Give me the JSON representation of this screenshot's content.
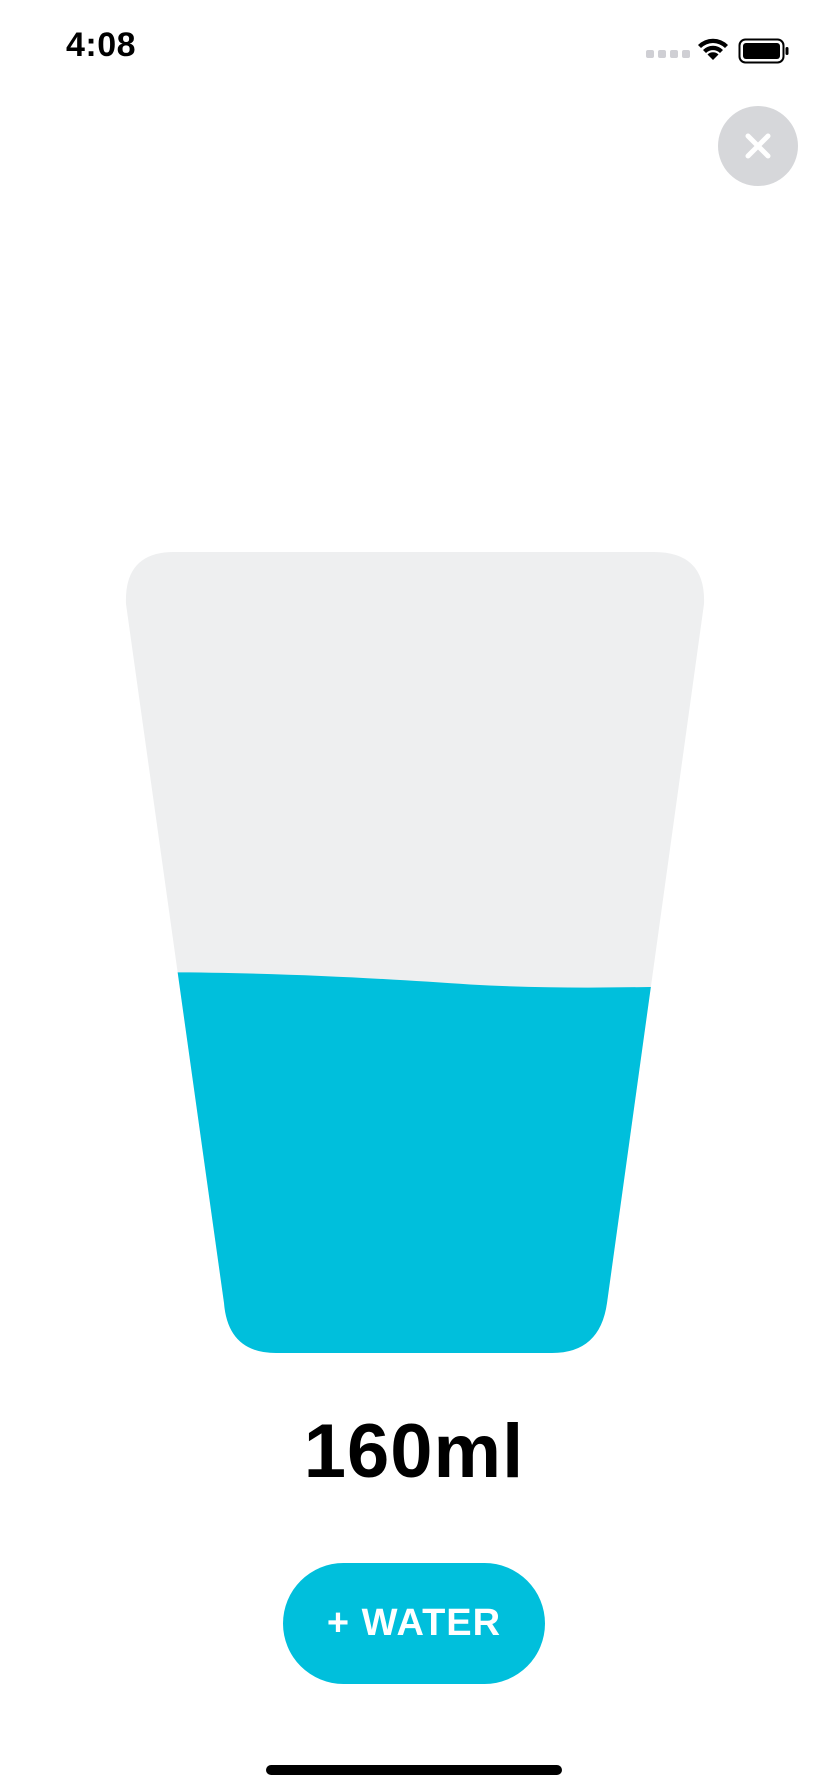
{
  "status_bar": {
    "time": "4:08",
    "icons": [
      "cellular-signal-icon",
      "wifi-icon",
      "battery-icon"
    ]
  },
  "close_button": {
    "icon": "close-icon"
  },
  "glass": {
    "fill_fraction": 0.47,
    "water_color": "#00bfdc",
    "empty_color": "#eeeff0"
  },
  "amount": {
    "text": "160ml"
  },
  "add_water_button": {
    "label": "+ WATER",
    "color": "#00bfdc"
  }
}
